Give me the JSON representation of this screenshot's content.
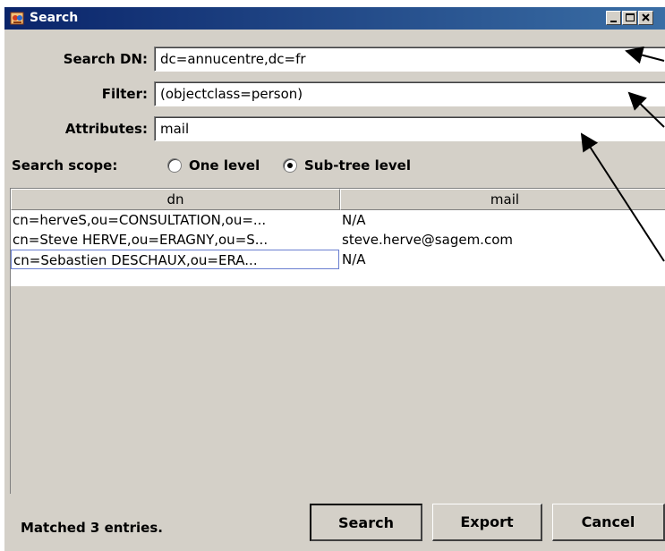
{
  "window": {
    "title": "Search",
    "icon": "ldap-search-icon",
    "controls": [
      "minimize-icon",
      "maximize-icon",
      "close-icon"
    ]
  },
  "form": {
    "search_dn": {
      "label": "Search DN:",
      "value": "dc=annucentre,dc=fr"
    },
    "filter": {
      "label": "Filter:",
      "value": "(objectclass=person)"
    },
    "attributes": {
      "label": "Attributes:",
      "value": "mail"
    }
  },
  "scope": {
    "label": "Search scope:",
    "options": [
      {
        "label": "One level",
        "selected": false
      },
      {
        "label": "Sub-tree level",
        "selected": true
      }
    ]
  },
  "table": {
    "columns": [
      "dn",
      "mail"
    ],
    "rows": [
      [
        "cn=herveS,ou=CONSULTATION,ou=...",
        "N/A"
      ],
      [
        "cn=Steve HERVE,ou=ERAGNY,ou=S...",
        "steve.herve@sagem.com"
      ],
      [
        "cn=Sebastien DESCHAUX,ou=ERA...",
        "N/A"
      ]
    ]
  },
  "status": "Matched 3 entries.",
  "buttons": {
    "search": "Search",
    "export": "Export",
    "cancel": "Cancel"
  },
  "colors": {
    "titlebar_start": "#0a246a",
    "titlebar_end": "#3a6ea5",
    "window_bg": "#d4d0c8"
  }
}
